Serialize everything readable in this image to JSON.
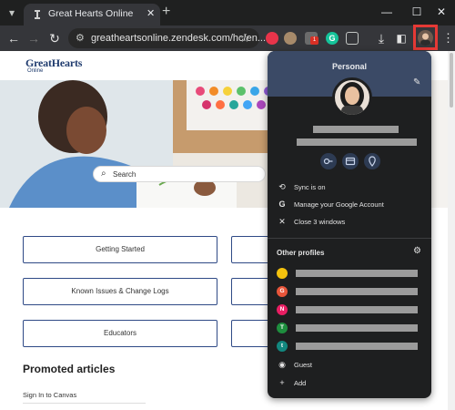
{
  "browser": {
    "tab_title": "Great Hearts Online",
    "tab_close": "✕",
    "new_tab": "+",
    "window_controls": [
      "—",
      "☐",
      "✕"
    ],
    "url": "greatheartsonline.zendesk.com/hc/en...",
    "extensions": [
      {
        "name": "extension-red-icon",
        "color": "#e8344a",
        "badge": ""
      },
      {
        "name": "extension-owl-icon",
        "color": "#a78a6a",
        "badge": ""
      },
      {
        "name": "extension-badge-icon",
        "color": "#6b6b6b",
        "badge": "1"
      },
      {
        "name": "extension-grammarly-icon",
        "color": "#15c39a",
        "badge": ""
      },
      {
        "name": "extensions-puzzle-icon",
        "color": "#c4c7c5",
        "badge": ""
      }
    ]
  },
  "page": {
    "logo": "GreatHearts",
    "logo_sub": "Online",
    "search_placeholder": "Search",
    "categories": [
      "Getting Started",
      "Known Issues & Change Logs",
      "Educators"
    ],
    "promoted_heading": "Promoted articles",
    "first_article": "Sign In to Canvas"
  },
  "menu": {
    "title": "Personal",
    "account_items": [
      {
        "icon": "sync-icon",
        "glyph": "⟲",
        "label": "Sync is on"
      },
      {
        "icon": "google-g-icon",
        "glyph": "G",
        "label": "Manage your Google Account"
      },
      {
        "icon": "close-icon",
        "glyph": "✕",
        "label": "Close 3 windows"
      }
    ],
    "other_profiles_title": "Other profiles",
    "other_profiles": [
      {
        "initial": "",
        "color": "#f4c20d"
      },
      {
        "initial": "G",
        "color": "#e8553a"
      },
      {
        "initial": "N",
        "color": "#e91e63"
      },
      {
        "initial": "T",
        "color": "#1e8e3e"
      },
      {
        "initial": "t",
        "color": "#12877f"
      }
    ],
    "guest_label": "Guest",
    "add_label": "Add"
  }
}
